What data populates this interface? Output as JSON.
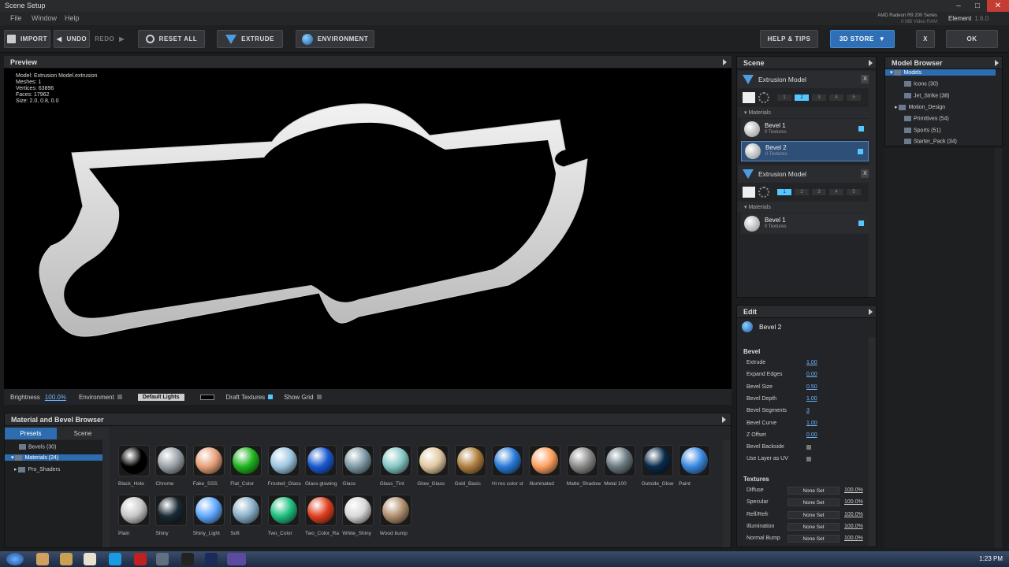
{
  "window": {
    "title": "Scene Setup"
  },
  "menu": [
    "File",
    "Window",
    "Help"
  ],
  "gpu": {
    "name": "AMD Radeon R9 200 Series",
    "vram": "0 MB Video RAM"
  },
  "app": {
    "name": "Element",
    "version": "1.6.0"
  },
  "toolbar": {
    "import": "IMPORT",
    "undo": "UNDO",
    "redo": "REDO",
    "reset_all": "RESET ALL",
    "extrude": "EXTRUDE",
    "environment": "ENVIRONMENT",
    "help": "HELP & TIPS",
    "store": "3D STORE",
    "close": "X",
    "ok": "OK"
  },
  "preview": {
    "title": "Preview",
    "stats": [
      "Model: Extrusion Model.extrusion",
      "Meshes: 1",
      "Vertices: 63896",
      "Faces: 17962",
      "Size: 2.0, 0.8, 0.0"
    ],
    "brightness_label": "Brightness",
    "brightness_value": "100.0%",
    "environment_label": "Environment",
    "lights_value": "Default Lights",
    "draft_textures_label": "Draft Textures",
    "show_grid_label": "Show Grid"
  },
  "material_browser": {
    "title": "Material and Bevel Browser",
    "tabs": [
      "Presets",
      "Scene"
    ],
    "tree": [
      "Bevels (30)",
      "Materials (24)",
      "Pro_Shaders"
    ],
    "swatches": [
      {
        "label": "Black_Hole",
        "color": "#000"
      },
      {
        "label": "Chrome",
        "color": "#9aa3a8"
      },
      {
        "label": "Fake_SSS",
        "color": "#e8a07a"
      },
      {
        "label": "Flat_Color",
        "color": "#1fb51f"
      },
      {
        "label": "Frosted_Glass",
        "color": "#9ec6e0"
      },
      {
        "label": "Glass glowing",
        "color": "#1a5ad0"
      },
      {
        "label": "Glass",
        "color": "#7f9aa6"
      },
      {
        "label": "Glass_Tint",
        "color": "#86c8c4"
      },
      {
        "label": "Glow_Glass",
        "color": "#e0c8a0"
      },
      {
        "label": "Gold_Basic",
        "color": "#b08040"
      },
      {
        "label": "Hi res color st",
        "color": "#2a7ad8"
      },
      {
        "label": "Illuminated",
        "color": "#ffa060"
      },
      {
        "label": "Matte_Shadow",
        "color": "#8a8a8a"
      },
      {
        "label": "Metal 100",
        "color": "#6a7a80"
      },
      {
        "label": "Outside_Glow",
        "color": "#0a2a4a"
      },
      {
        "label": "Paint",
        "color": "#3a8ae0"
      },
      {
        "label": "Plain",
        "color": "#c8c8c8"
      },
      {
        "label": "Shiny",
        "color": "#1a2a34"
      },
      {
        "label": "Shiny_Light",
        "color": "#60a8ff"
      },
      {
        "label": "Soft",
        "color": "#8ab0c8"
      },
      {
        "label": "Two_Color",
        "color": "#20c080"
      },
      {
        "label": "Two_Color_Ra",
        "color": "#e04020"
      },
      {
        "label": "White_Shiny",
        "color": "#d8d8d8"
      },
      {
        "label": "Wood bump",
        "color": "#b09070"
      }
    ]
  },
  "scene": {
    "title": "Scene",
    "models": [
      {
        "name": "Extrusion Model",
        "modes": [
          "1",
          "2",
          "3",
          "4",
          "5"
        ],
        "active_mode": 1,
        "materials_label": "Materials",
        "materials": [
          {
            "name": "Bevel 1",
            "sub": "0 Textures"
          },
          {
            "name": "Bevel 2",
            "sub": "0 Textures"
          }
        ]
      },
      {
        "name": "Extrusion Model",
        "modes": [
          "1",
          "2",
          "3",
          "4",
          "5"
        ],
        "active_mode": 0,
        "materials_label": "Materials",
        "materials": [
          {
            "name": "Bevel 1",
            "sub": "0 Textures"
          }
        ]
      }
    ]
  },
  "model_browser": {
    "title": "Model Browser",
    "items": [
      "Models",
      "Icons (30)",
      "Jet_Strike (38)",
      "Motion_Design",
      "Primitives (54)",
      "Sports (51)",
      "Starter_Pack (34)"
    ]
  },
  "edit": {
    "title": "Edit",
    "selected": "Bevel 2",
    "bevel_section": "Bevel",
    "props": [
      {
        "label": "Extrude",
        "value": "1.00"
      },
      {
        "label": "Expand Edges",
        "value": "0.00"
      },
      {
        "label": "Bevel Size",
        "value": "0.50"
      },
      {
        "label": "Bevel Depth",
        "value": "1.00"
      },
      {
        "label": "Bevel Segments",
        "value": "3"
      },
      {
        "label": "Bevel Curve",
        "value": "1.00"
      },
      {
        "label": "Z Offset",
        "value": "0.00"
      },
      {
        "label": "Bevel Backside",
        "value": ""
      },
      {
        "label": "Use Layer as UV",
        "value": ""
      }
    ],
    "textures_section": "Textures",
    "textures": [
      {
        "label": "Diffuse",
        "set": "None Set",
        "pct": "100.0%"
      },
      {
        "label": "Specular",
        "set": "None Set",
        "pct": "100.0%"
      },
      {
        "label": "Refl/Refr",
        "set": "None Set",
        "pct": "100.0%"
      },
      {
        "label": "Illumination",
        "set": "None Set",
        "pct": "100.0%"
      },
      {
        "label": "Normal Bump",
        "set": "None Set",
        "pct": "100.0%"
      }
    ]
  },
  "taskbar": {
    "time": "1:23 PM"
  }
}
